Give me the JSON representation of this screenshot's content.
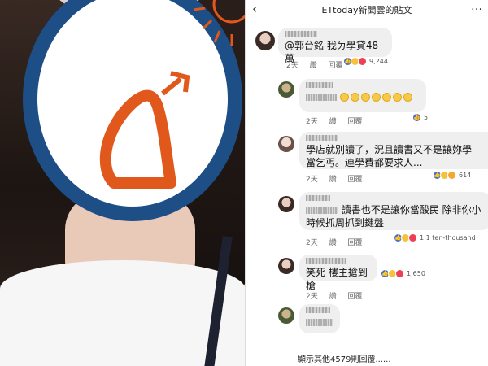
{
  "header": {
    "back_icon": "chevron-left-icon",
    "title": "ETtoday新聞雲的貼文",
    "more": "…"
  },
  "photo": {
    "circle_color": "#1d4e86",
    "sketch_color": "#e0581c"
  },
  "comments": [
    {
      "text": "@郭台銘 我ㄉ學貸48萬",
      "time": "2天",
      "like": "讚",
      "reply": "回覆",
      "reactions": "9,244"
    },
    {
      "text": "",
      "time": "2天",
      "like": "讚",
      "reply": "回覆",
      "reactions": "5"
    },
    {
      "text_line1": "學店就別讀了，況且讀書又不是讓妳學",
      "text_line2": "當乞丐。連學費都要求人...",
      "time": "2天",
      "like": "讚",
      "reply": "回覆",
      "reactions": "614"
    },
    {
      "text_line1": "讀書也不是讓你當酸民 除非你小",
      "text_line2": "時候抓周抓到鍵盤",
      "time": "2天",
      "like": "讚",
      "reply": "回覆",
      "reactions": "1.1 ten-thousand"
    },
    {
      "text": "笑死 樓主搶到槍",
      "time": "2天",
      "like": "讚",
      "reply": "回覆",
      "reactions": "1,650"
    },
    {
      "text": "",
      "time": "",
      "like": "",
      "reply": "",
      "reactions": ""
    }
  ],
  "more_replies": "顯示其他4579則回覆......",
  "colors": {
    "like": "#3b6fe0",
    "haha": "#f5c33b",
    "love": "#ed3f55",
    "bubble": "#efefef"
  }
}
